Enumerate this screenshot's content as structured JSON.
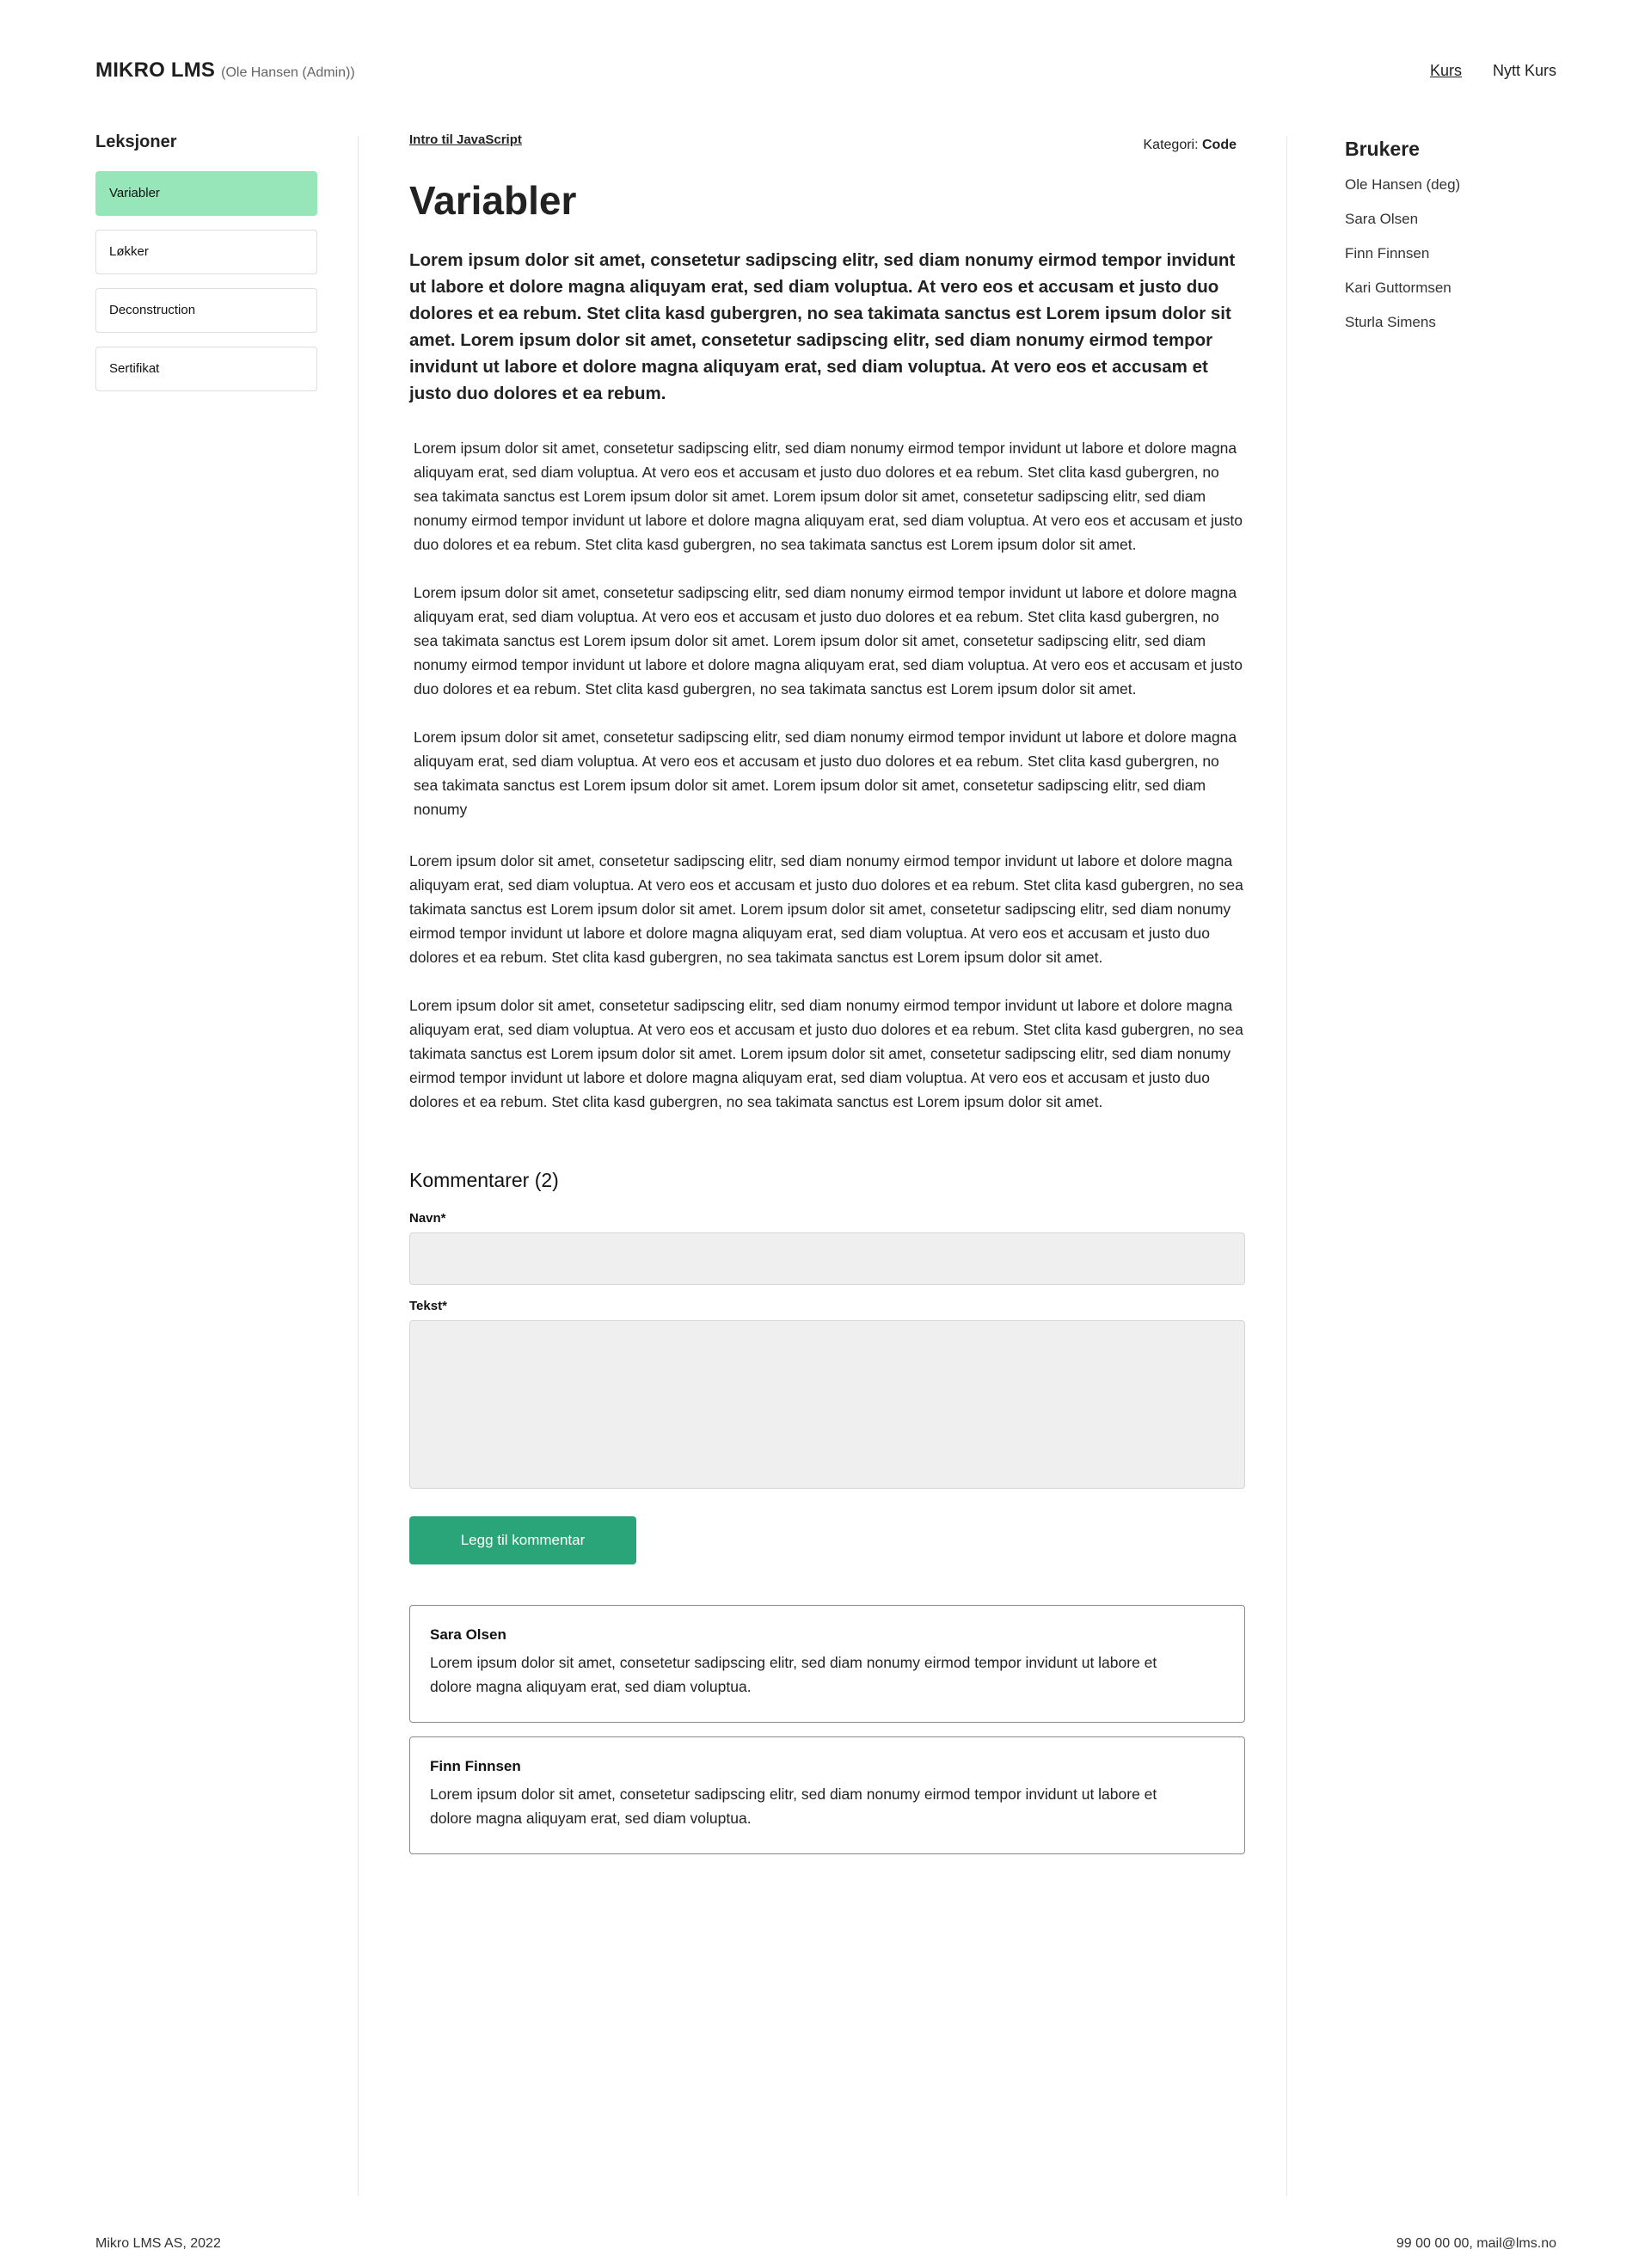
{
  "header": {
    "brand": "MIKRO LMS",
    "user_label": "(Ole Hansen (Admin))",
    "nav": [
      {
        "label": "Kurs"
      },
      {
        "label": "Nytt Kurs"
      }
    ]
  },
  "sidebar": {
    "title": "Leksjoner",
    "lessons": [
      {
        "label": "Variabler"
      },
      {
        "label": "Løkker"
      },
      {
        "label": "Deconstruction"
      },
      {
        "label": "Sertifikat"
      }
    ]
  },
  "main": {
    "breadcrumb": "Intro til JavaScript",
    "category_label": "Kategori:",
    "category_value": "Code",
    "title": "Variabler",
    "lead": "Lorem ipsum dolor sit amet, consetetur sadipscing elitr, sed diam nonumy eirmod tempor invidunt ut labore et dolore magna aliquyam erat, sed diam voluptua. At vero eos et accusam et justo duo dolores et ea rebum. Stet clita kasd gubergren, no sea takimata sanctus est Lorem ipsum dolor sit amet. Lorem ipsum dolor sit amet, consetetur sadipscing elitr, sed diam nonumy eirmod tempor invidunt ut labore et dolore magna aliquyam erat, sed diam voluptua. At vero eos et accusam et justo duo dolores et ea rebum.",
    "paragraphs": [
      "Lorem ipsum dolor sit amet, consetetur sadipscing elitr, sed diam nonumy eirmod tempor invidunt ut labore et dolore magna aliquyam erat, sed diam voluptua. At vero eos et accusam et justo duo dolores et ea rebum. Stet clita kasd gubergren, no sea takimata sanctus est Lorem ipsum dolor sit amet. Lorem ipsum dolor sit amet, consetetur sadipscing elitr, sed diam nonumy eirmod tempor invidunt ut labore et dolore magna aliquyam erat, sed diam voluptua. At vero eos et accusam et justo duo dolores et ea rebum. Stet clita kasd gubergren, no sea takimata sanctus est Lorem ipsum dolor sit amet.",
      "Lorem ipsum dolor sit amet, consetetur sadipscing elitr, sed diam nonumy eirmod tempor invidunt ut labore et dolore magna aliquyam erat, sed diam voluptua. At vero eos et accusam et justo duo dolores et ea rebum. Stet clita kasd gubergren, no sea takimata sanctus est Lorem ipsum dolor sit amet. Lorem ipsum dolor sit amet, consetetur sadipscing elitr, sed diam nonumy eirmod tempor invidunt ut labore et dolore magna aliquyam erat, sed diam voluptua. At vero eos et accusam et justo duo dolores et ea rebum. Stet clita kasd gubergren, no sea takimata sanctus est Lorem ipsum dolor sit amet.",
      "Lorem ipsum dolor sit amet, consetetur sadipscing elitr, sed diam nonumy eirmod tempor invidunt ut labore et dolore magna aliquyam erat, sed diam voluptua. At vero eos et accusam et justo duo dolores et ea rebum. Stet clita kasd gubergren, no sea takimata sanctus est Lorem ipsum dolor sit amet. Lorem ipsum dolor sit amet, consetetur sadipscing elitr, sed diam nonumy",
      "Lorem ipsum dolor sit amet, consetetur sadipscing elitr, sed diam nonumy eirmod tempor invidunt ut labore et dolore magna aliquyam erat, sed diam voluptua. At vero eos et accusam et justo duo dolores et ea rebum. Stet clita kasd gubergren, no sea takimata sanctus est Lorem ipsum dolor sit amet. Lorem ipsum dolor sit amet, consetetur sadipscing elitr, sed diam nonumy eirmod tempor invidunt ut labore et dolore magna aliquyam erat, sed diam voluptua. At vero eos et accusam et justo duo dolores et ea rebum. Stet clita kasd gubergren, no sea takimata sanctus est Lorem ipsum dolor sit amet.",
      "Lorem ipsum dolor sit amet, consetetur sadipscing elitr, sed diam nonumy eirmod tempor invidunt ut labore et dolore magna aliquyam erat, sed diam voluptua. At vero eos et accusam et justo duo dolores et ea rebum. Stet clita kasd gubergren, no sea takimata sanctus est Lorem ipsum dolor sit amet. Lorem ipsum dolor sit amet, consetetur sadipscing elitr, sed diam nonumy eirmod tempor invidunt ut labore et dolore magna aliquyam erat, sed diam voluptua. At vero eos et accusam et justo duo dolores et ea rebum. Stet clita kasd gubergren, no sea takimata sanctus est Lorem ipsum dolor sit amet."
    ]
  },
  "comments": {
    "title": "Kommentarer (2)",
    "name_label": "Navn*",
    "name_value": "",
    "text_label": "Tekst*",
    "text_value": "",
    "submit_label": "Legg til kommentar",
    "items": [
      {
        "author": "Sara Olsen",
        "text": "Lorem ipsum dolor sit amet, consetetur sadipscing elitr, sed diam nonumy eirmod tempor invidunt ut labore et dolore magna aliquyam erat, sed diam voluptua."
      },
      {
        "author": "Finn Finnsen",
        "text": "Lorem ipsum dolor sit amet, consetetur sadipscing elitr, sed diam nonumy eirmod tempor invidunt ut labore et dolore magna aliquyam erat, sed diam voluptua."
      }
    ]
  },
  "users": {
    "title": "Brukere",
    "list": [
      {
        "name": "Ole Hansen (deg)"
      },
      {
        "name": "Sara Olsen"
      },
      {
        "name": "Finn Finnsen"
      },
      {
        "name": "Kari Guttormsen"
      },
      {
        "name": "Sturla Simens"
      }
    ]
  },
  "footer": {
    "left": "Mikro LMS AS, 2022",
    "right": "99 00 00 00, mail@lms.no"
  },
  "colors": {
    "active_lesson": "#97e6b9",
    "button": "#2aa57a",
    "input_bg": "#efefef"
  }
}
